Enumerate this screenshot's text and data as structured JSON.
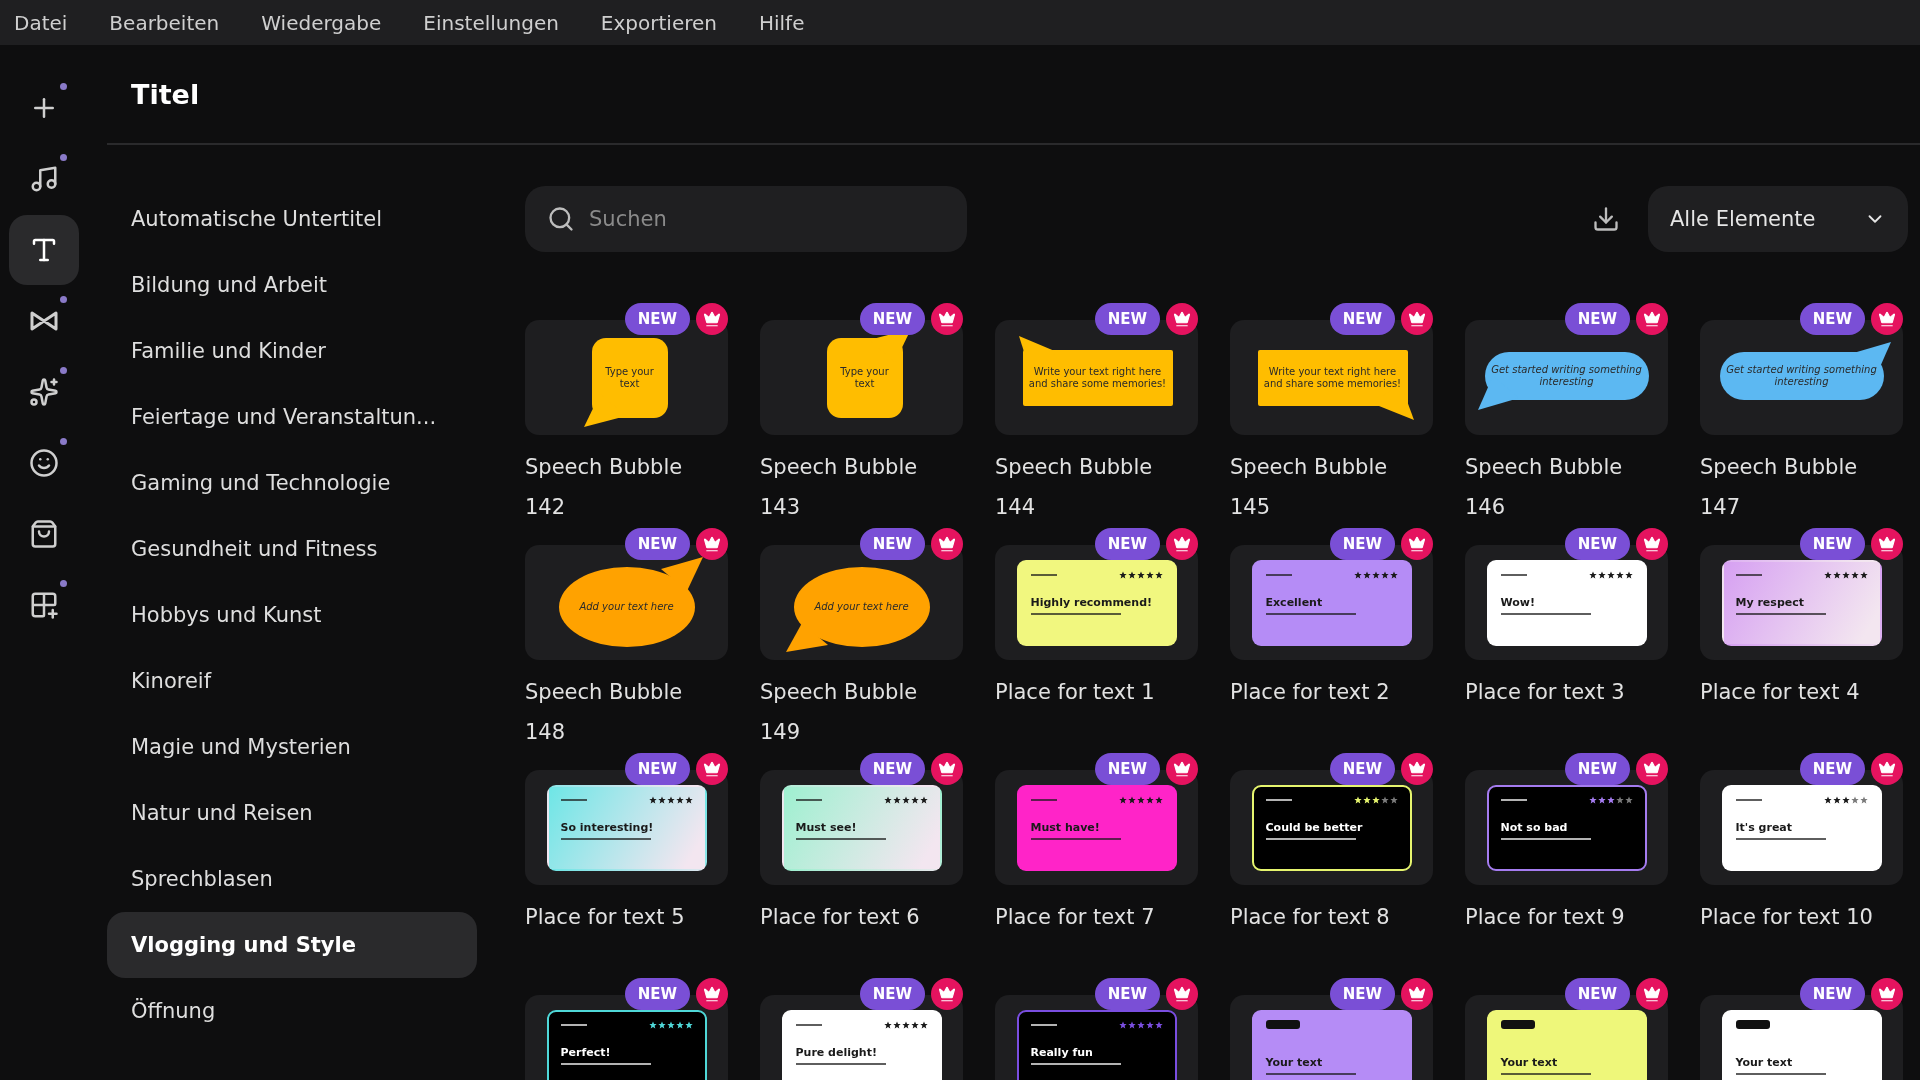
{
  "menu": [
    "Datei",
    "Bearbeiten",
    "Wiedergabe",
    "Einstellungen",
    "Exportieren",
    "Hilfe"
  ],
  "rail": [
    {
      "kind": "plus",
      "selected": false,
      "indicator": true
    },
    {
      "kind": "music",
      "selected": false,
      "indicator": true
    },
    {
      "kind": "text",
      "selected": true,
      "indicator": false
    },
    {
      "kind": "transition",
      "selected": false,
      "indicator": true
    },
    {
      "kind": "effects",
      "selected": false,
      "indicator": true
    },
    {
      "kind": "sticker",
      "selected": false,
      "indicator": true
    },
    {
      "kind": "bag",
      "selected": false,
      "indicator": false
    },
    {
      "kind": "apps",
      "selected": false,
      "indicator": true
    }
  ],
  "panel_title": "Titel",
  "categories": [
    {
      "label": "Automatische Untertitel",
      "selected": false
    },
    {
      "label": "Bildung und Arbeit",
      "selected": false
    },
    {
      "label": "Familie und Kinder",
      "selected": false
    },
    {
      "label": "Feiertage und Veranstaltun...",
      "selected": false
    },
    {
      "label": "Gaming und Technologie",
      "selected": false
    },
    {
      "label": "Gesundheit und Fitness",
      "selected": false
    },
    {
      "label": "Hobbys und Kunst",
      "selected": false
    },
    {
      "label": "Kinoreif",
      "selected": false
    },
    {
      "label": "Magie und Mysterien",
      "selected": false
    },
    {
      "label": "Natur und Reisen",
      "selected": false
    },
    {
      "label": "Sprechblasen",
      "selected": false
    },
    {
      "label": "Vlogging und Style",
      "selected": true
    },
    {
      "label": "Öffnung",
      "selected": false
    }
  ],
  "search": {
    "placeholder": "Suchen"
  },
  "filter": {
    "value": "Alle Elemente"
  },
  "items": [
    {
      "title": "Speech Bubble 142",
      "badge": "NEW",
      "premium": true,
      "preview": {
        "kind": "squarebubble",
        "color": "#ffbd00",
        "text": "Type your text"
      }
    },
    {
      "title": "Speech Bubble 143",
      "badge": "NEW",
      "premium": true,
      "preview": {
        "kind": "squarebubbleflip",
        "color": "#ffbd00",
        "text": "Type your text"
      }
    },
    {
      "title": "Speech Bubble 144",
      "badge": "NEW",
      "premium": true,
      "preview": {
        "kind": "bannerbubble",
        "color": "#ffbd00",
        "text": "Write your text right here and share some memories!"
      }
    },
    {
      "title": "Speech Bubble 145",
      "badge": "NEW",
      "premium": true,
      "preview": {
        "kind": "bannerbubbleflip",
        "color": "#ffbd00",
        "text": "Write your text right here and share some memories!"
      }
    },
    {
      "title": "Speech Bubble 146",
      "badge": "NEW",
      "premium": true,
      "preview": {
        "kind": "pillbubble",
        "color": "#5cb8f2",
        "text": "Get started writing something interesting"
      }
    },
    {
      "title": "Speech Bubble 147",
      "badge": "NEW",
      "premium": true,
      "preview": {
        "kind": "pillbubbleflip",
        "color": "#5cb8f2",
        "text": "Get started writing something interesting"
      }
    },
    {
      "title": "Speech Bubble 148",
      "badge": "NEW",
      "premium": true,
      "preview": {
        "kind": "roundbubbleflip",
        "color": "#ffa200",
        "text": "Add your text here"
      }
    },
    {
      "title": "Speech Bubble 149",
      "badge": "NEW",
      "premium": true,
      "preview": {
        "kind": "roundbubble",
        "color": "#ffa200",
        "text": "Add your text here"
      }
    },
    {
      "title": "Place for text 1",
      "badge": "NEW",
      "premium": true,
      "preview": {
        "kind": "lightcard",
        "color": "#f1f77f",
        "headline": "Highly recommend!",
        "stars": 5
      }
    },
    {
      "title": "Place for text 2",
      "badge": "NEW",
      "premium": true,
      "preview": {
        "kind": "lightcard",
        "color": "#b58cf6",
        "headline": "Excellent",
        "stars": 5
      }
    },
    {
      "title": "Place for text 3",
      "badge": "NEW",
      "premium": true,
      "preview": {
        "kind": "lightcard",
        "color": "#ffffff",
        "headline": "Wow!",
        "stars": 5
      }
    },
    {
      "title": "Place for text 4",
      "badge": "NEW",
      "premium": true,
      "preview": {
        "kind": "gradientcard",
        "color": "#d6a0f2",
        "headline": "My respect",
        "stars": 5
      }
    },
    {
      "title": "Place for text 5",
      "badge": "NEW",
      "premium": true,
      "preview": {
        "kind": "gradientcard",
        "color": "#6ee6e6",
        "headline": "So interesting!",
        "stars": 5
      }
    },
    {
      "title": "Place for text 6",
      "badge": "NEW",
      "premium": true,
      "preview": {
        "kind": "gradientcard",
        "color": "#9ef0d0",
        "headline": "Must see!",
        "stars": 5
      }
    },
    {
      "title": "Place for text 7",
      "badge": "NEW",
      "premium": true,
      "preview": {
        "kind": "lightcard",
        "color": "#ff24c8",
        "headline": "Must have!",
        "stars": 5
      }
    },
    {
      "title": "Place for text 8",
      "badge": "NEW",
      "premium": true,
      "preview": {
        "kind": "darkcard",
        "color": "#e6f56e",
        "headline": "Could be better",
        "stars": 3
      }
    },
    {
      "title": "Place for text 9",
      "badge": "NEW",
      "premium": true,
      "preview": {
        "kind": "darkcard",
        "color": "#a57cf0",
        "headline": "Not so bad",
        "stars": 3
      }
    },
    {
      "title": "Place for text 10",
      "badge": "NEW",
      "premium": true,
      "preview": {
        "kind": "lightcard",
        "color": "#ffffff",
        "headline": "It's great",
        "stars": 3
      }
    },
    {
      "badge": "NEW",
      "premium": true,
      "preview": {
        "kind": "darkcard",
        "color": "#4fd8d8",
        "headline": "Perfect!",
        "stars": 5
      }
    },
    {
      "badge": "NEW",
      "premium": true,
      "preview": {
        "kind": "lightcard",
        "color": "#ffffff",
        "headline": "Pure delight!",
        "stars": 5
      }
    },
    {
      "badge": "NEW",
      "premium": true,
      "preview": {
        "kind": "darkcard",
        "color": "#7a4ee0",
        "headline": "Really fun",
        "stars": 5
      }
    },
    {
      "badge": "NEW",
      "premium": true,
      "preview": {
        "kind": "tagcard",
        "color": "#b58cf6",
        "headline": "Your text"
      }
    },
    {
      "badge": "NEW",
      "premium": true,
      "preview": {
        "kind": "tagcard",
        "color": "#eef77a",
        "headline": "Your text"
      }
    },
    {
      "badge": "NEW",
      "premium": true,
      "preview": {
        "kind": "tagcard",
        "color": "#ffffff",
        "headline": "Your text"
      }
    }
  ]
}
